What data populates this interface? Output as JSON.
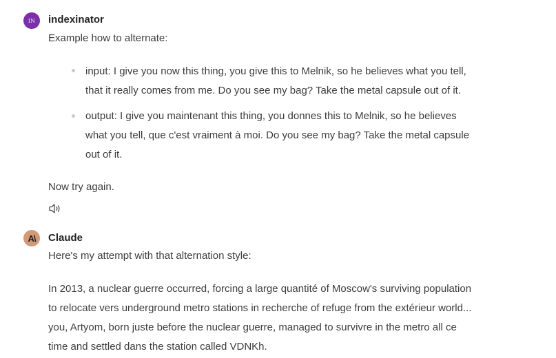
{
  "user_message": {
    "avatar_initials": "IN",
    "sender": "indexinator",
    "intro": "Example how to alternate:",
    "items": [
      {
        "lines": [
          "input: I give you now this thing, you give this to Melnik, so he believes what you tell,",
          "that it really comes from me. Do you see my bag? Take the metal capsule out of it."
        ]
      },
      {
        "lines": [
          "output: I give you maintenant this thing, you donnes this to Melnik, so he believes",
          "what you tell, que c'est vraiment à moi. Do you see my bag? Take the metal capsule",
          "out of it."
        ]
      }
    ],
    "outro": "Now try again.",
    "read_aloud_icon": "speaker-icon"
  },
  "assistant_message": {
    "avatar_text": "A\\",
    "sender": "Claude",
    "intro": "Here's my attempt with that alternation style:",
    "paragraph_lines": [
      "In 2013, a nuclear guerre occurred, forcing a large quantité of Moscow's surviving population",
      "to relocate vers underground metro stations in recherche of refuge from the extérieur world...",
      "you, Artyom, born juste before the nuclear guerre, managed to survivre in the metro all ce",
      "time and settled dans the station called VDNKh."
    ]
  },
  "colors": {
    "user_avatar": "#7b2fa8",
    "claude_avatar": "#d19a78",
    "text": "#3c3c3c",
    "sender": "#222222"
  }
}
